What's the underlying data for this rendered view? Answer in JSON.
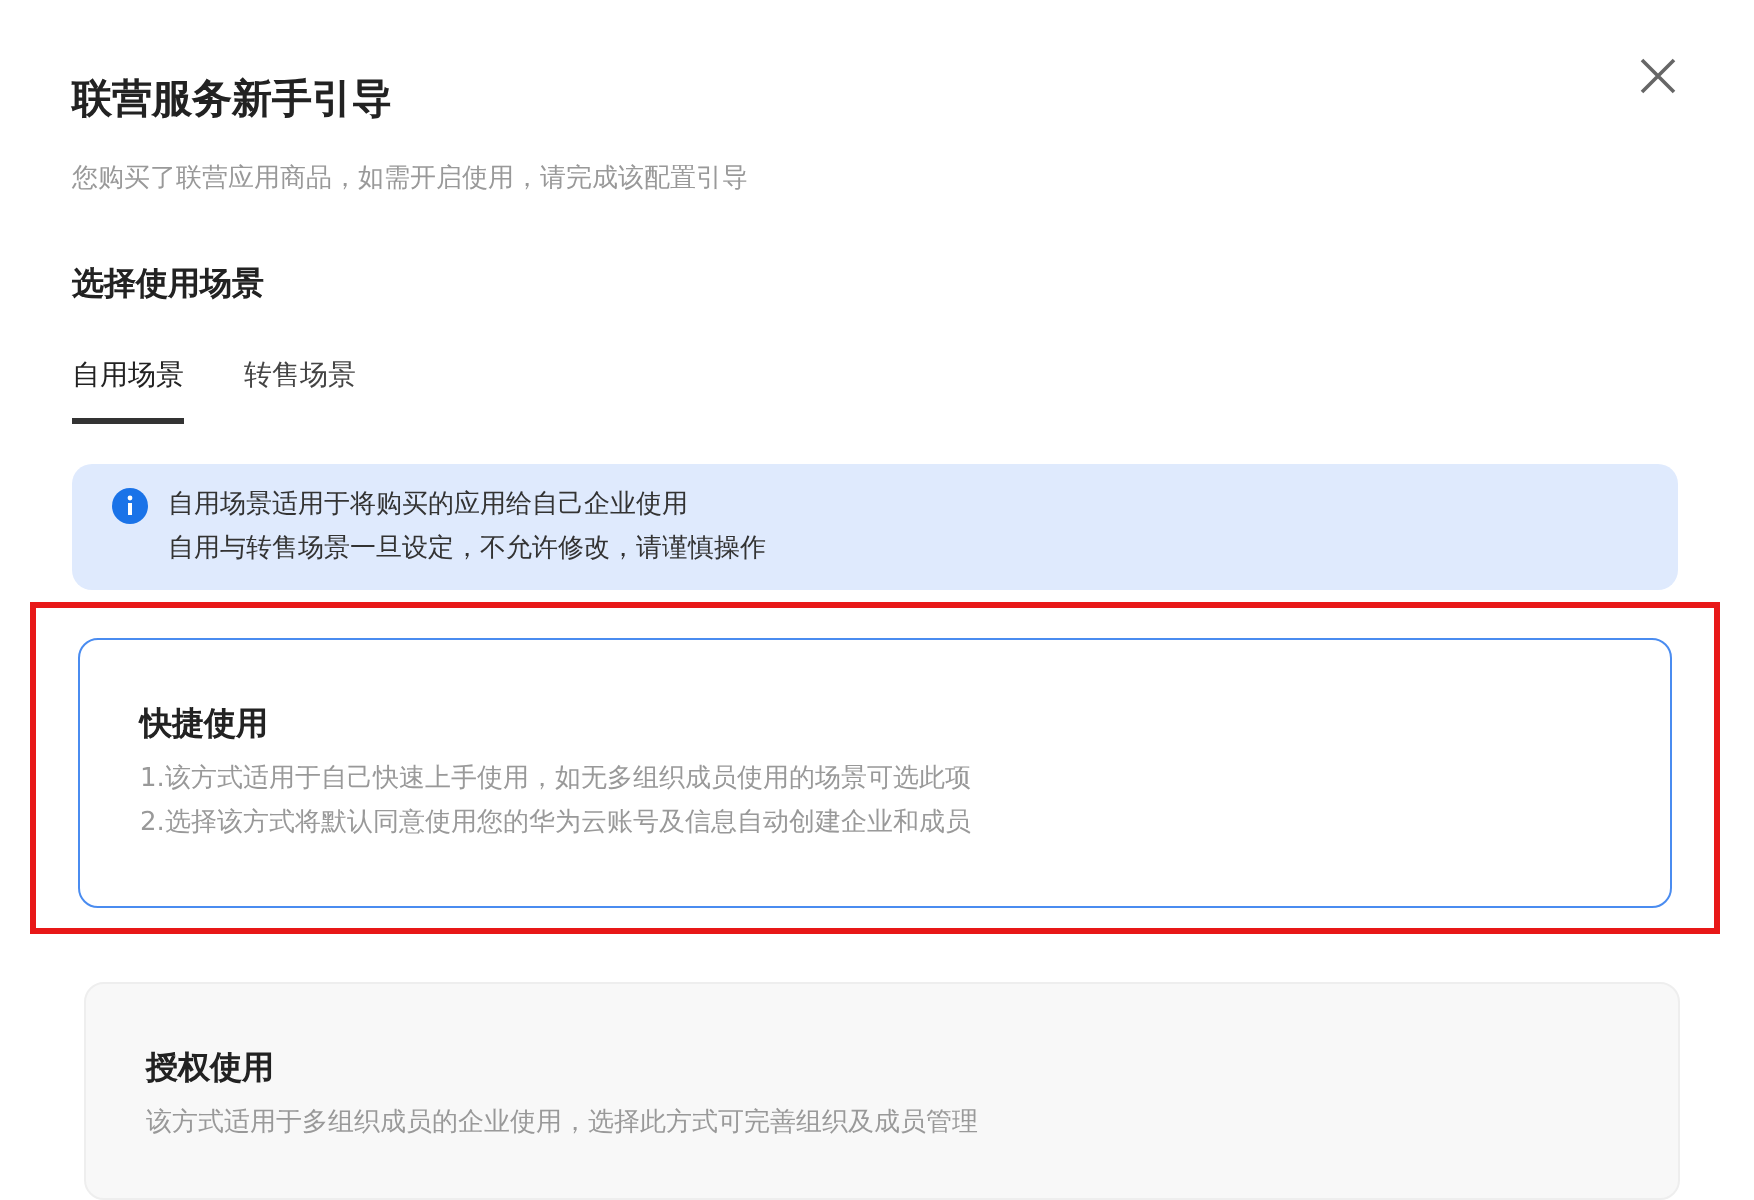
{
  "dialog": {
    "title": "联营服务新手引导",
    "subtitle": "您购买了联营应用商品，如需开启使用，请完成该配置引导"
  },
  "section": {
    "heading": "选择使用场景"
  },
  "tabs": [
    {
      "label": "自用场景",
      "selected": true
    },
    {
      "label": "转售场景",
      "selected": false
    }
  ],
  "notice": {
    "lines": [
      "自用场景适用于将购买的应用给自己企业使用",
      "自用与转售场景一旦设定，不允许修改，请谨慎操作"
    ]
  },
  "options": [
    {
      "title": "快捷使用",
      "lines": [
        "1.该方式适用于自己快速上手使用，如无多组织成员使用的场景可选此项",
        "2.选择该方式将默认同意使用您的华为云账号及信息自动创建企业和成员"
      ],
      "selected": true,
      "highlighted": true
    },
    {
      "title": "授权使用",
      "lines": [
        "该方式适用于多组织成员的企业使用，选择此方式可完善组织及成员管理"
      ],
      "selected": false,
      "highlighted": false
    }
  ]
}
